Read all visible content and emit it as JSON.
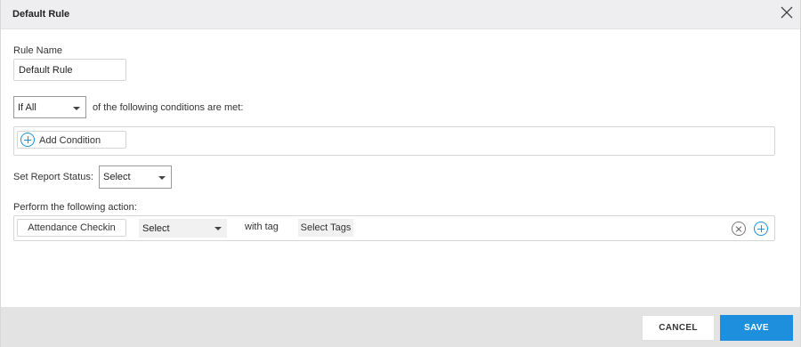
{
  "dialog": {
    "title": "Default Rule"
  },
  "rule_name": {
    "label": "Rule Name",
    "value": "Default Rule"
  },
  "conditions": {
    "match_select_value": "If All",
    "suffix_text": "of the following conditions are met:",
    "add_condition_label": "Add Condition"
  },
  "report_status": {
    "label": "Set Report Status:",
    "select_value": "Select"
  },
  "action": {
    "label": "Perform the following action:",
    "action_button_label": "Attendance Checkin",
    "select_value": "Select",
    "with_tag_text": "with tag",
    "tags_placeholder": "Select Tags"
  },
  "footer": {
    "cancel_label": "CANCEL",
    "save_label": "SAVE"
  },
  "colors": {
    "accent": "#1e8fdd",
    "header_bg": "#eeeef0",
    "footer_bg": "#e3e3e3"
  },
  "icons": {
    "close": "close-icon",
    "add": "plus-circle-icon",
    "remove": "remove-circle-icon"
  }
}
